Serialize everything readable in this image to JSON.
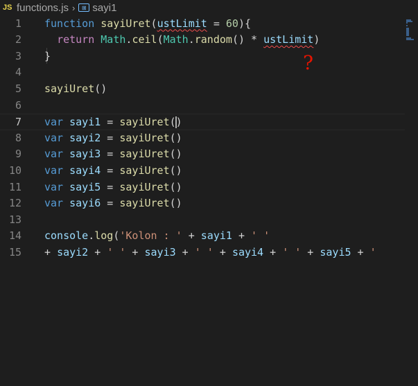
{
  "breadcrumb": {
    "file_icon": "JS",
    "file_name": "functions.js",
    "separator": "›",
    "symbol_icon": "symbol-variable-icon",
    "symbol_name": "sayi1"
  },
  "annotation": {
    "text": "?",
    "color": "#e51400"
  },
  "editor": {
    "line_numbers": [
      "1",
      "2",
      "3",
      "4",
      "5",
      "6",
      "7",
      "8",
      "9",
      "10",
      "11",
      "12",
      "13",
      "14",
      "15"
    ],
    "active_line": 7,
    "lines": [
      [
        {
          "t": "function",
          "c": "kw"
        },
        {
          "t": " "
        },
        {
          "t": "sayiUret",
          "c": "fn"
        },
        {
          "t": "("
        },
        {
          "t": "ustLimit",
          "c": "var err"
        },
        {
          "t": " = "
        },
        {
          "t": "60",
          "c": "num"
        },
        {
          "t": "){"
        }
      ],
      [
        {
          "t": "  "
        },
        {
          "t": "return",
          "c": "kw2"
        },
        {
          "t": " "
        },
        {
          "t": "Math",
          "c": "ty"
        },
        {
          "t": "."
        },
        {
          "t": "ceil",
          "c": "fn"
        },
        {
          "t": "("
        },
        {
          "t": "Math",
          "c": "ty"
        },
        {
          "t": "."
        },
        {
          "t": "random",
          "c": "fn"
        },
        {
          "t": "() * "
        },
        {
          "t": "ustLimit",
          "c": "var err"
        },
        {
          "t": ")"
        }
      ],
      [
        {
          "t": "}"
        }
      ],
      [],
      [
        {
          "t": "sayiUret",
          "c": "fn"
        },
        {
          "t": "()"
        }
      ],
      [],
      [
        {
          "t": "var",
          "c": "kw"
        },
        {
          "t": " "
        },
        {
          "t": "sayi1",
          "c": "var"
        },
        {
          "t": " = "
        },
        {
          "t": "sayiUret",
          "c": "fn"
        },
        {
          "t": "("
        },
        {
          "cursor": true
        },
        {
          "t": ")"
        }
      ],
      [
        {
          "t": "var",
          "c": "kw"
        },
        {
          "t": " "
        },
        {
          "t": "sayi2",
          "c": "var"
        },
        {
          "t": " = "
        },
        {
          "t": "sayiUret",
          "c": "fn"
        },
        {
          "t": "()"
        }
      ],
      [
        {
          "t": "var",
          "c": "kw"
        },
        {
          "t": " "
        },
        {
          "t": "sayi3",
          "c": "var"
        },
        {
          "t": " = "
        },
        {
          "t": "sayiUret",
          "c": "fn"
        },
        {
          "t": "()"
        }
      ],
      [
        {
          "t": "var",
          "c": "kw"
        },
        {
          "t": " "
        },
        {
          "t": "sayi4",
          "c": "var"
        },
        {
          "t": " = "
        },
        {
          "t": "sayiUret",
          "c": "fn"
        },
        {
          "t": "()"
        }
      ],
      [
        {
          "t": "var",
          "c": "kw"
        },
        {
          "t": " "
        },
        {
          "t": "sayi5",
          "c": "var"
        },
        {
          "t": " = "
        },
        {
          "t": "sayiUret",
          "c": "fn"
        },
        {
          "t": "()"
        }
      ],
      [
        {
          "t": "var",
          "c": "kw"
        },
        {
          "t": " "
        },
        {
          "t": "sayi6",
          "c": "var"
        },
        {
          "t": " = "
        },
        {
          "t": "sayiUret",
          "c": "fn"
        },
        {
          "t": "()"
        }
      ],
      [],
      [
        {
          "t": "console",
          "c": "var"
        },
        {
          "t": "."
        },
        {
          "t": "log",
          "c": "fn"
        },
        {
          "t": "("
        },
        {
          "t": "'Kolon : '",
          "c": "str"
        },
        {
          "t": " + "
        },
        {
          "t": "sayi1",
          "c": "var"
        },
        {
          "t": " + "
        },
        {
          "t": "' '",
          "c": "str"
        }
      ],
      [
        {
          "t": "+ "
        },
        {
          "t": "sayi2",
          "c": "var"
        },
        {
          "t": " + "
        },
        {
          "t": "' '",
          "c": "str"
        },
        {
          "t": " + "
        },
        {
          "t": "sayi3",
          "c": "var"
        },
        {
          "t": " + "
        },
        {
          "t": "' '",
          "c": "str"
        },
        {
          "t": " + "
        },
        {
          "t": "sayi4",
          "c": "var"
        },
        {
          "t": " + "
        },
        {
          "t": "' '",
          "c": "str"
        },
        {
          "t": " + "
        },
        {
          "t": "sayi5",
          "c": "var"
        },
        {
          "t": " + "
        },
        {
          "t": "'",
          "c": "str"
        }
      ]
    ]
  }
}
